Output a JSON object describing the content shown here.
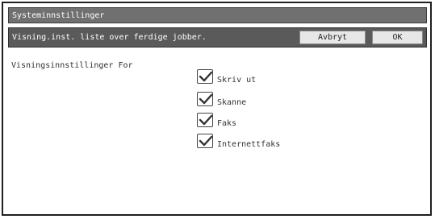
{
  "window": {
    "title": "Systeminnstillinger"
  },
  "header": {
    "subtitle": "Visning.inst. liste over ferdige jobber.",
    "cancel_label": "Avbryt",
    "ok_label": "OK"
  },
  "main": {
    "section_label": "Visningsinnstillinger For",
    "options": [
      {
        "label": "Skriv ut",
        "checked": true
      },
      {
        "label": "Skanne",
        "checked": true
      },
      {
        "label": "Faks",
        "checked": true
      },
      {
        "label": "Internettfaks",
        "checked": true
      }
    ]
  },
  "icons": {
    "checkbox": "checkmark-icon"
  }
}
